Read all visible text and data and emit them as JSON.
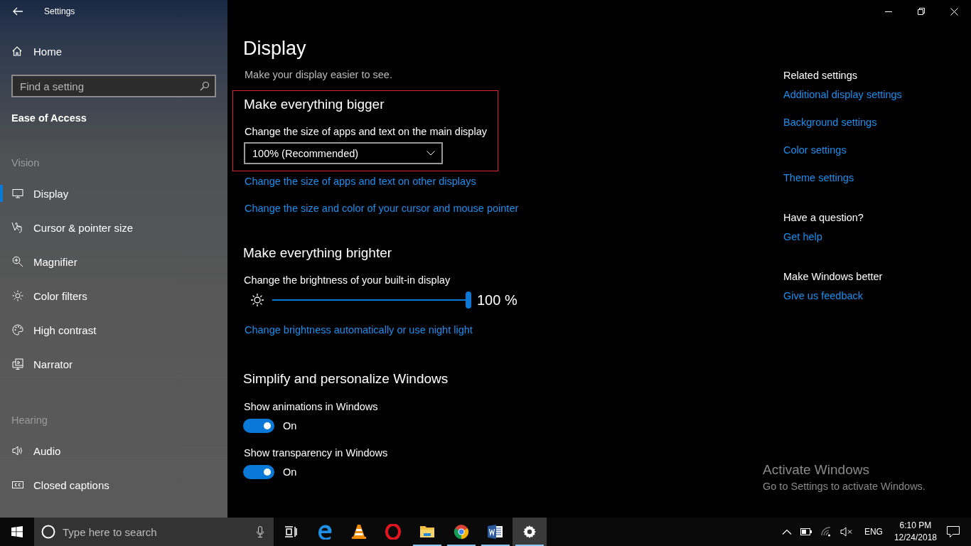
{
  "window": {
    "title": "Settings"
  },
  "sidebar": {
    "home": "Home",
    "search": {
      "placeholder": "Find a setting"
    },
    "category": "Ease of Access",
    "groups": [
      {
        "heading": "Vision",
        "items": [
          {
            "label": "Display",
            "selected": true
          },
          {
            "label": "Cursor & pointer size",
            "selected": false
          },
          {
            "label": "Magnifier",
            "selected": false
          },
          {
            "label": "Color filters",
            "selected": false
          },
          {
            "label": "High contrast",
            "selected": false
          },
          {
            "label": "Narrator",
            "selected": false
          }
        ]
      },
      {
        "heading": "Hearing",
        "items": [
          {
            "label": "Audio",
            "selected": false
          },
          {
            "label": "Closed captions",
            "selected": false
          }
        ]
      }
    ]
  },
  "page": {
    "title": "Display",
    "subtitle": "Make your display easier to see.",
    "sections": [
      {
        "kind": "dropdown",
        "heading": "Make everything bigger",
        "highlighted": true,
        "label": "Change the size of apps and text on the main display",
        "value": "100% (Recommended)",
        "links": [
          "Change the size of apps and text on other displays",
          "Change the size and color of your cursor and mouse pointer"
        ]
      },
      {
        "kind": "slider",
        "heading": "Make everything brighter",
        "label": "Change the brightness of your built-in display",
        "level": 1,
        "reading": "100 %",
        "links": [
          "Change brightness automatically or use night light"
        ]
      },
      {
        "kind": "toggles",
        "heading": "Simplify and personalize Windows",
        "toggles": [
          {
            "label": "Show animations in Windows",
            "on": true,
            "state_text": "On"
          },
          {
            "label": "Show transparency in Windows",
            "on": true,
            "state_text": "On"
          }
        ]
      }
    ]
  },
  "related": [
    {
      "heading": "Related settings",
      "links": [
        "Additional display settings",
        "Background settings",
        "Color settings",
        "Theme settings"
      ]
    },
    {
      "heading": "Have a question?",
      "links": [
        "Get help"
      ]
    },
    {
      "heading": "Make Windows better",
      "links": [
        "Give us feedback"
      ]
    }
  ],
  "activation": {
    "title": "Activate Windows",
    "text": "Go to Settings to activate Windows."
  },
  "taskbar": {
    "search": {
      "placeholder": "Type here to search"
    },
    "apps": [
      {
        "running": false,
        "selected": false
      },
      {
        "running": false,
        "selected": false
      },
      {
        "running": false,
        "selected": false
      },
      {
        "running": false,
        "selected": false
      },
      {
        "running": true,
        "selected": false
      },
      {
        "running": true,
        "selected": false
      },
      {
        "running": true,
        "selected": false
      },
      {
        "running": true,
        "selected": true
      }
    ],
    "language": "ENG",
    "time": "6:10 PM",
    "date": "12/24/2018"
  }
}
